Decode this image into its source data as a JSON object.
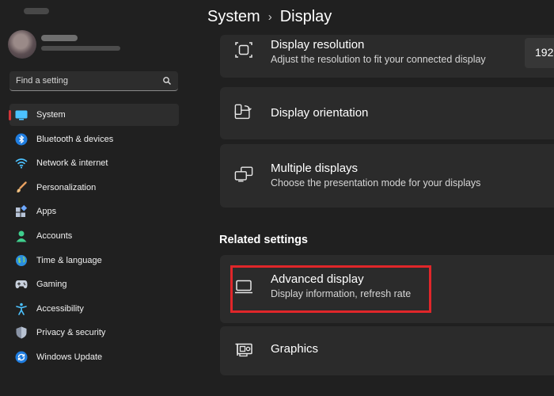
{
  "search": {
    "placeholder": "Find a setting"
  },
  "sidebar": {
    "items": [
      {
        "label": "System",
        "icon": "system-icon",
        "selected": true
      },
      {
        "label": "Bluetooth & devices",
        "icon": "bluetooth-icon"
      },
      {
        "label": "Network & internet",
        "icon": "wifi-icon"
      },
      {
        "label": "Personalization",
        "icon": "brush-icon"
      },
      {
        "label": "Apps",
        "icon": "apps-icon"
      },
      {
        "label": "Accounts",
        "icon": "person-icon"
      },
      {
        "label": "Time & language",
        "icon": "globe-icon"
      },
      {
        "label": "Gaming",
        "icon": "gamepad-icon"
      },
      {
        "label": "Accessibility",
        "icon": "accessibility-icon"
      },
      {
        "label": "Privacy & security",
        "icon": "shield-icon"
      },
      {
        "label": "Windows Update",
        "icon": "update-icon"
      }
    ]
  },
  "breadcrumb": {
    "parent": "System",
    "separator": "›",
    "current": "Display"
  },
  "cards": {
    "resolution": {
      "title": "Display resolution",
      "subtitle": "Adjust the resolution to fit your connected display",
      "value": "192"
    },
    "orientation": {
      "title": "Display orientation"
    },
    "multiple": {
      "title": "Multiple displays",
      "subtitle": "Choose the presentation mode for your displays"
    }
  },
  "related": {
    "heading": "Related settings",
    "advanced": {
      "title": "Advanced display",
      "subtitle": "Display information, refresh rate"
    },
    "graphics": {
      "title": "Graphics"
    }
  },
  "colors": {
    "background": "#202020",
    "card": "#2b2b2b",
    "selection_accent": "#d13438",
    "highlight_box": "#e0262a"
  }
}
